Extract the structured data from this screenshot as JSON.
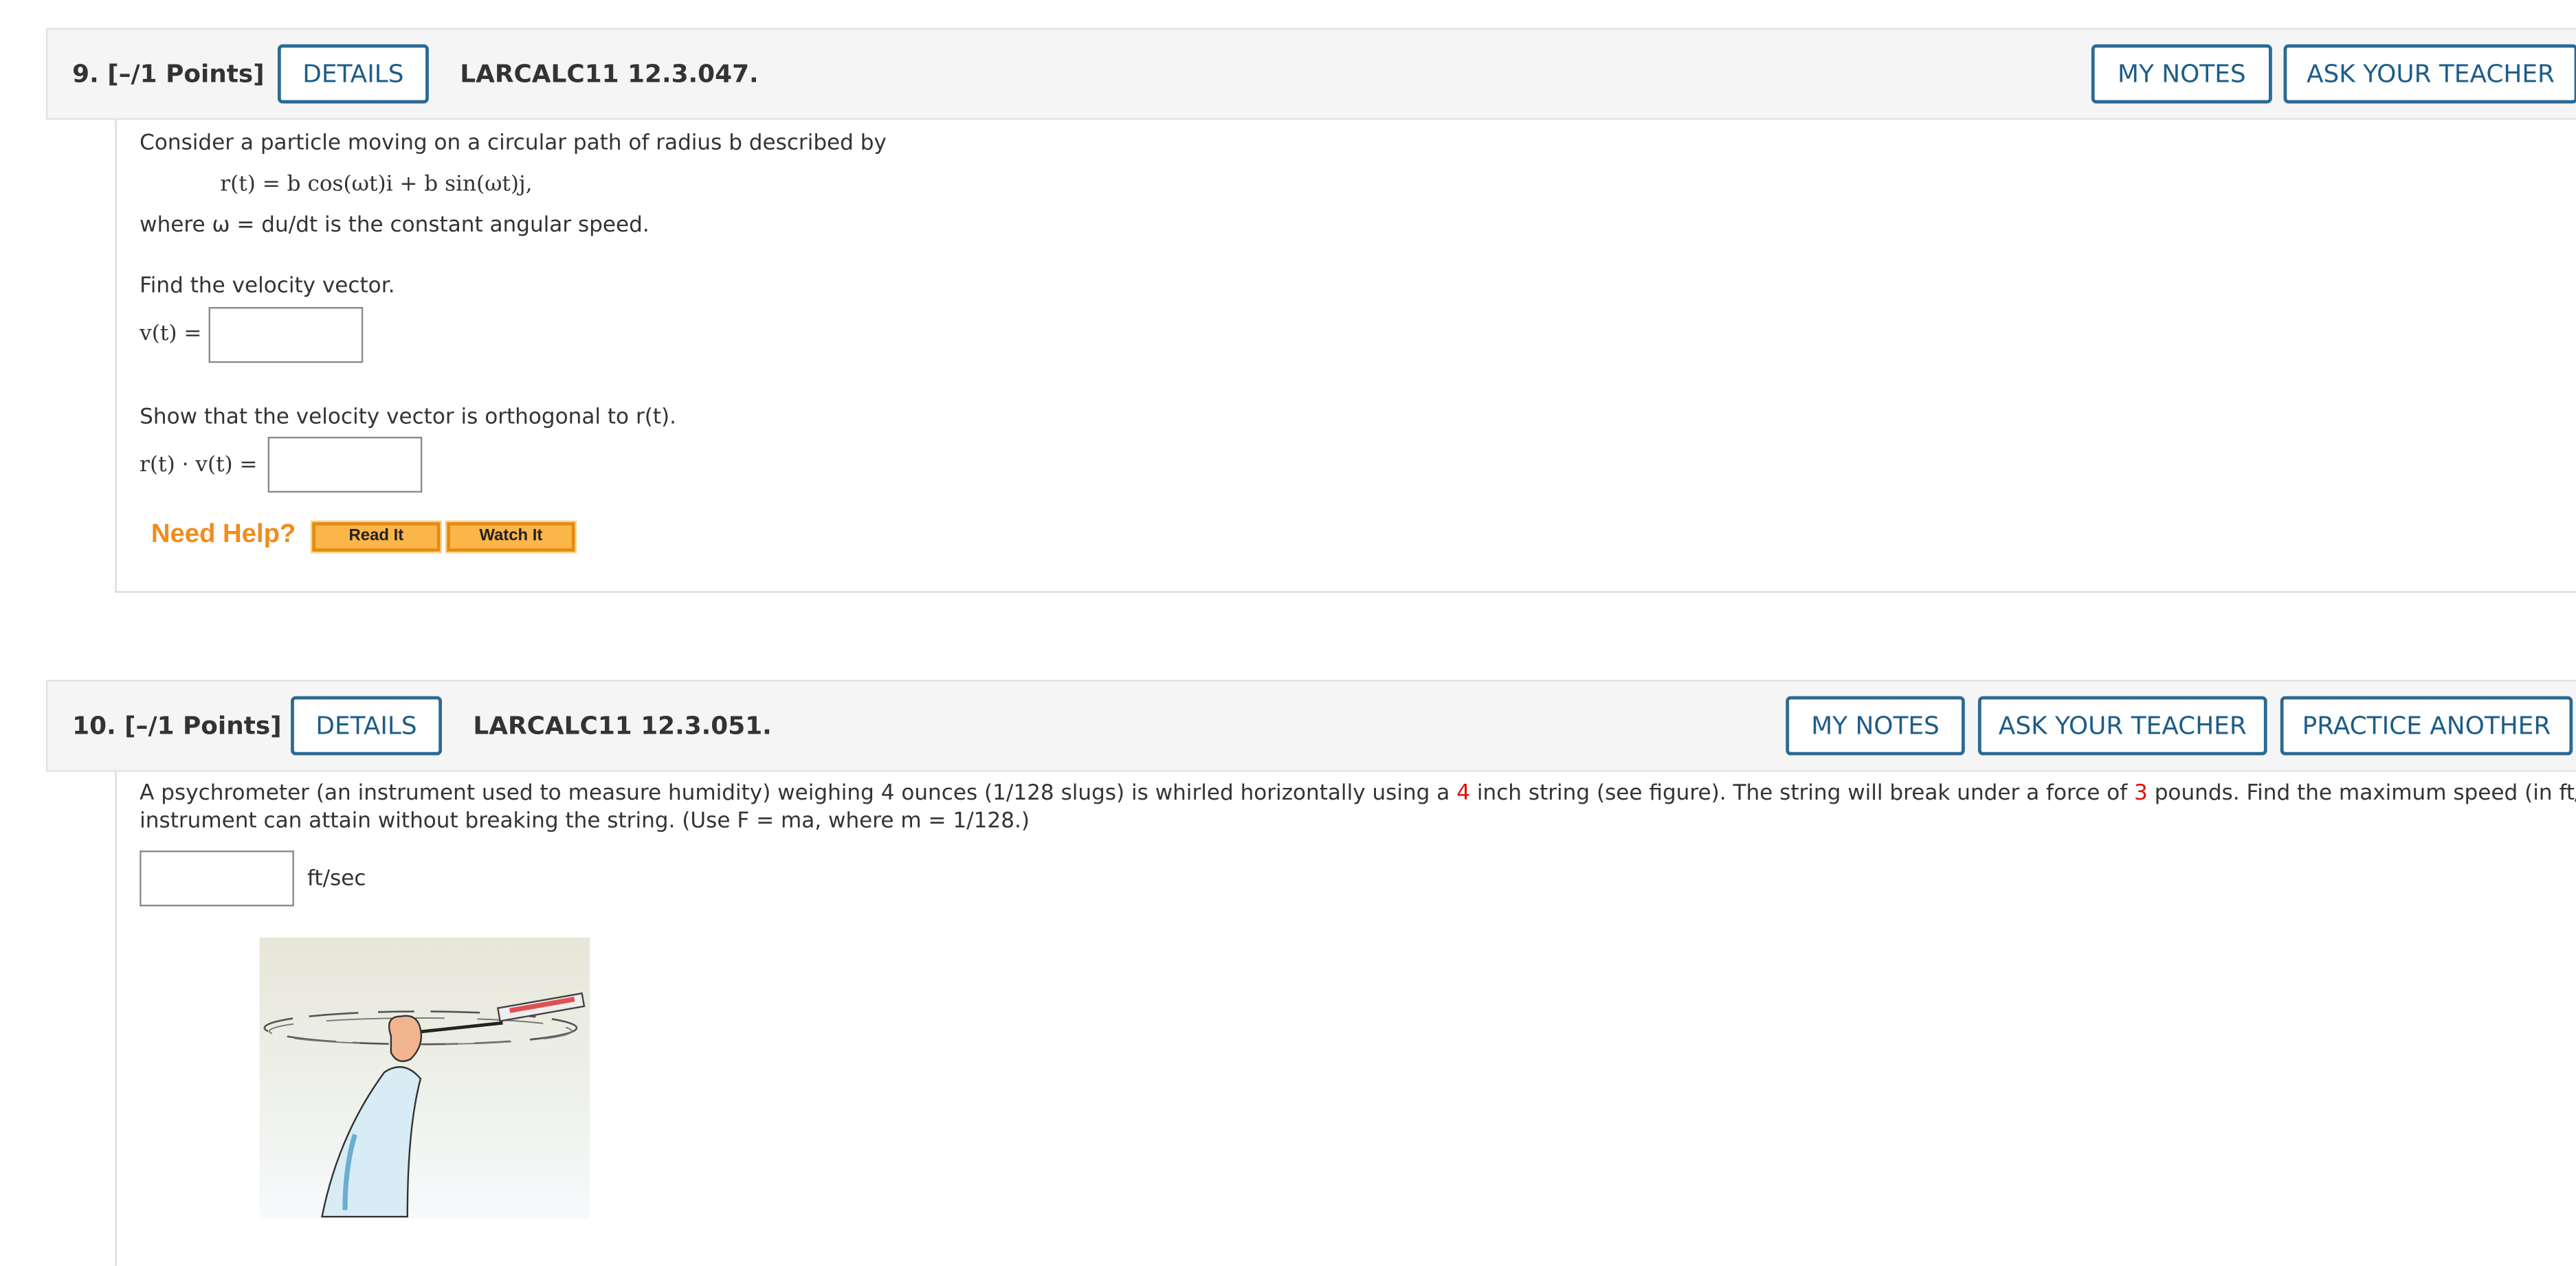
{
  "q9": {
    "number": "9.  [–/1 Points]",
    "details": "DETAILS",
    "code": "LARCALC11 12.3.047.",
    "my_notes": "MY NOTES",
    "ask_teacher": "ASK YOUR TEACHER",
    "intro": "Consider a particle moving on a circular path of radius b described by",
    "equation": "r(t) = b cos(ωt)i + b sin(ωt)j,",
    "where": "where ω = du/dt is the constant angular speed.",
    "find_velocity": "Find the velocity vector.",
    "v_label": "v(t) =",
    "orthogonal_prompt": "Show that the velocity vector is orthogonal to r(t).",
    "dot_label": "r(t) · v(t) =",
    "v_value": "",
    "dot_value": "",
    "need_help": "Need Help?",
    "read_it": "Read It",
    "watch_it": "Watch It"
  },
  "q10": {
    "number": "10.  [–/1 Points]",
    "details": "DETAILS",
    "code": "LARCALC11 12.3.051.",
    "my_notes": "MY NOTES",
    "ask_teacher": "ASK YOUR TEACHER",
    "practice": "PRACTICE ANOTHER",
    "text_a": "A psychrometer (an instrument used to measure humidity) weighing 4 ounces (1/128 slugs) is whirled horizontally using a ",
    "string_length": "4",
    "text_b": " inch string (see figure). The string will break under a force of ",
    "force": "3",
    "text_c": " pounds. Find the maximum speed (in ft/sec) the",
    "line2": "instrument can attain without breaking the string. (Use F = ma, where m = 1/128.)",
    "answer_value": "",
    "unit": "ft/sec"
  },
  "colors": {
    "button_border": "#2b6a93",
    "button_text": "#1d5d89",
    "help_orange": "#f28c1a",
    "help_button": "#fbb64a",
    "highlight_red": "#d11111"
  }
}
